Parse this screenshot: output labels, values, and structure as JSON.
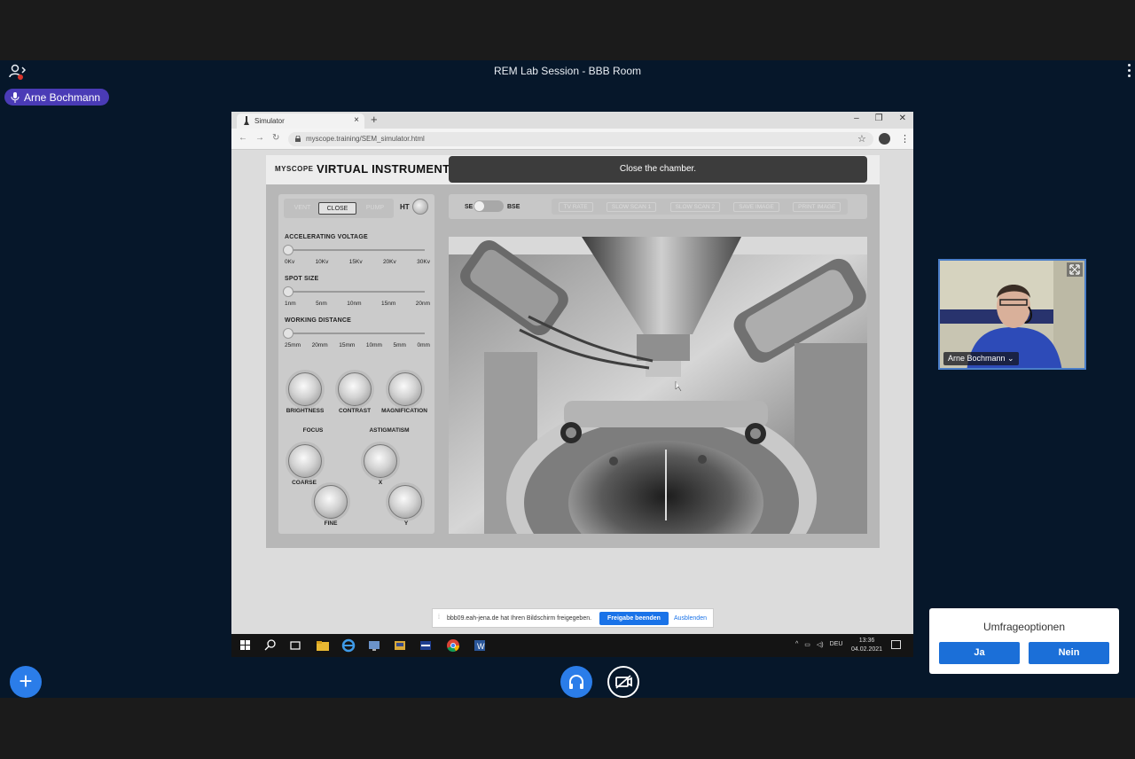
{
  "bbb": {
    "room_title": "REM Lab Session - BBB Room",
    "talker": "Arne Bochmann",
    "colors": {
      "background": "#06172a",
      "accent": "#2b7de9",
      "talker": "#4a3bb6"
    }
  },
  "browser": {
    "tab_title": "Simulator",
    "url": "myscope.training/SEM_simulator.html"
  },
  "instrument": {
    "logo": "MYSCOPE",
    "title": "VIRTUAL INSTRUMENT",
    "message": "Close the chamber.",
    "vac_buttons": [
      "VENT",
      "CLOSE",
      "PUMP"
    ],
    "ht_label": "HT",
    "accelerating_voltage": {
      "label": "ACCELERATING VOLTAGE",
      "ticks": [
        "0Kv",
        "10Kv",
        "15Kv",
        "20Kv",
        "30Kv"
      ]
    },
    "spot_size": {
      "label": "SPOT SIZE",
      "ticks": [
        "1nm",
        "5nm",
        "10nm",
        "15nm",
        "20nm"
      ]
    },
    "working_distance": {
      "label": "WORKING DISTANCE",
      "ticks": [
        "25mm",
        "20mm",
        "15mm",
        "10mm",
        "5mm",
        "0mm"
      ]
    },
    "knobs": {
      "brightness": "BRIGHTNESS",
      "contrast": "CONTRAST",
      "magnification": "MAGNIFICATION",
      "focus": "FOCUS",
      "astigmatism": "ASTIGMATISM",
      "coarse": "COARSE",
      "fine": "FINE",
      "x": "X",
      "y": "Y"
    },
    "detector": {
      "left": "SE",
      "right": "BSE"
    },
    "scan_buttons": [
      "TV RATE",
      "SLOW SCAN 1",
      "SLOW SCAN 2",
      "SAVE IMAGE",
      "PRINT IMAGE"
    ]
  },
  "share_notice": {
    "text": "bbb09.eah-jena.de hat Ihren Bildschirm freigegeben.",
    "stop": "Freigabe beenden",
    "hide": "Ausblenden"
  },
  "taskbar": {
    "lang": "DEU",
    "time": "13:36",
    "date": "04.02.2021"
  },
  "webcam": {
    "name": "Arne Bochmann ⌄"
  },
  "poll": {
    "title": "Umfrageoptionen",
    "yes": "Ja",
    "no": "Nein"
  }
}
